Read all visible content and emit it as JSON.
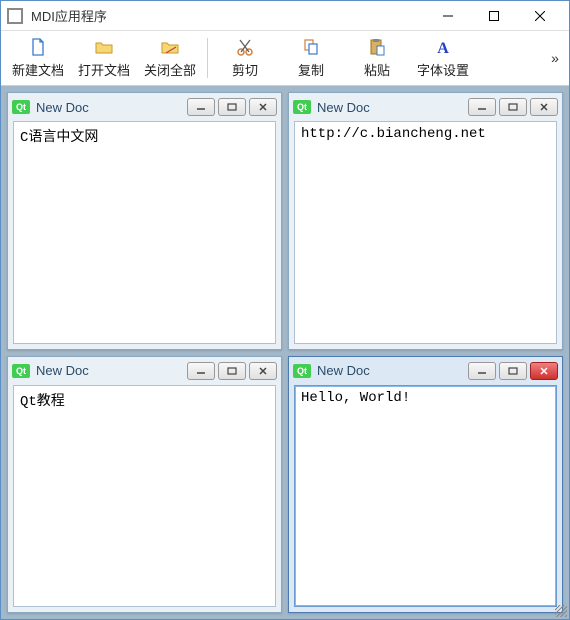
{
  "window": {
    "title": "MDI应用程序"
  },
  "toolbar": {
    "new_doc": "新建文档",
    "open_doc": "打开文档",
    "close_all": "关闭全部",
    "cut": "剪切",
    "copy": "复制",
    "paste": "粘贴",
    "font_settings": "字体设置"
  },
  "sub_title": "New Doc",
  "qt_label": "Qt",
  "docs": [
    {
      "content": "C语言中文网",
      "active": false
    },
    {
      "content": "http://c.biancheng.net",
      "active": false
    },
    {
      "content": "Qt教程",
      "active": false
    },
    {
      "content": "Hello, World!",
      "active": true
    }
  ]
}
